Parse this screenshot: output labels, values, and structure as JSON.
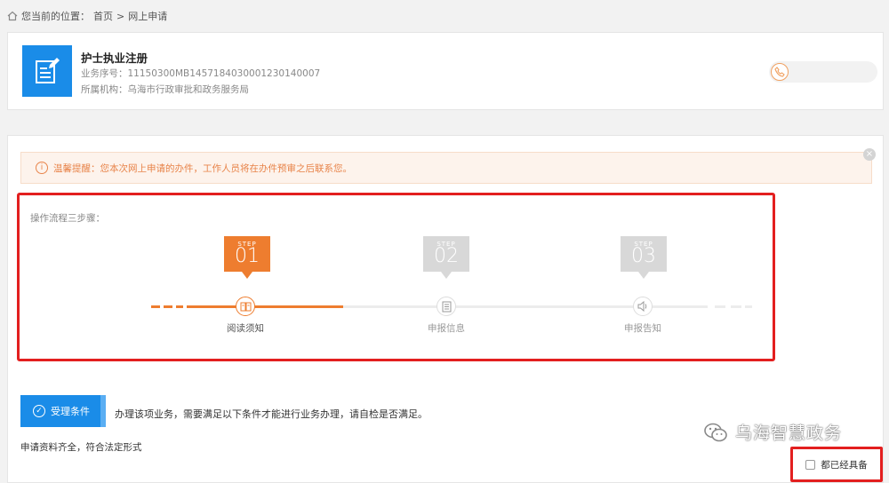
{
  "breadcrumb": {
    "prefix": "您当前的位置：",
    "home": "首页",
    "sep": ">",
    "current": "网上申请"
  },
  "service": {
    "title": "护士执业注册",
    "number": "业务序号：11150300MB1457184030001230140007",
    "org": "所属机构：乌海市行政审批和政务服务局"
  },
  "notice": {
    "text": "温馨提醒：您本次网上申请的办件，工作人员将在办件预审之后联系您。",
    "close": "×"
  },
  "steps": {
    "title": "操作流程三步骤：",
    "items": [
      {
        "label": "STEP",
        "num": "01",
        "name": "阅读须知",
        "active": true
      },
      {
        "label": "STEP",
        "num": "02",
        "name": "申报信息",
        "active": false
      },
      {
        "label": "STEP",
        "num": "03",
        "name": "申报告知",
        "active": false
      }
    ]
  },
  "conditions": {
    "button": "受理条件",
    "desc": "办理该项业务，需要满足以下条件才能进行业务办理，请自检是否满足。",
    "item": "申请资料齐全，符合法定形式",
    "checkbox_label": "都已经具备"
  },
  "watermark": "乌海智慧政务",
  "colors": {
    "accent_blue": "#1a8ce8",
    "active_orange": "#ee7d2f",
    "inactive_gray": "#d8d8d8",
    "highlight_red": "#e31f1f"
  }
}
